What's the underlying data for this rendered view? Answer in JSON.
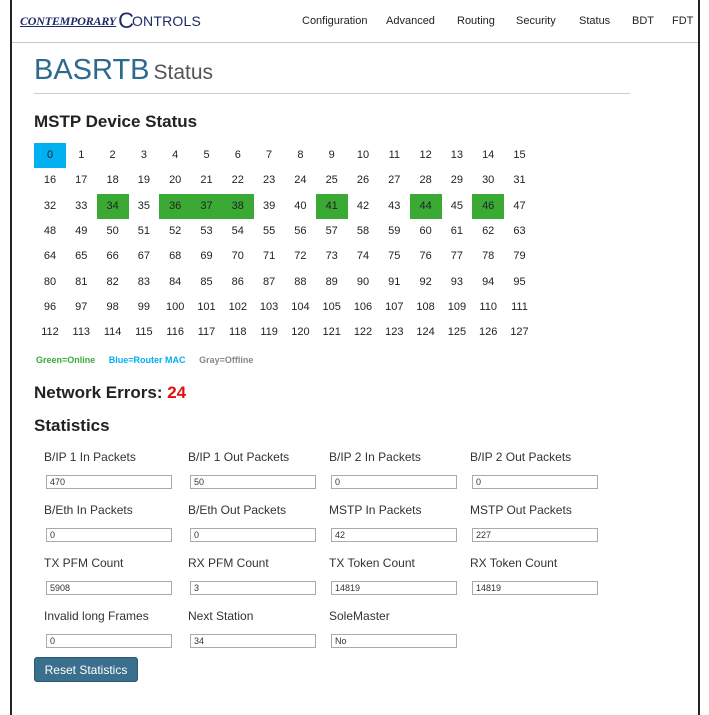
{
  "brand": {
    "line1": "CONTEMPORARY",
    "line2": "ONTROLS"
  },
  "nav": [
    "Configuration",
    "Advanced",
    "Routing",
    "Security",
    "Status",
    "BDT",
    "FDT"
  ],
  "title": {
    "main": "BASRTB",
    "sub": "Status"
  },
  "mstp": {
    "heading": "MSTP Device Status",
    "devices": [
      "0",
      "1",
      "2",
      "3",
      "4",
      "5",
      "6",
      "7",
      "8",
      "9",
      "10",
      "11",
      "12",
      "13",
      "14",
      "15",
      "16",
      "17",
      "18",
      "19",
      "20",
      "21",
      "22",
      "23",
      "24",
      "25",
      "26",
      "27",
      "28",
      "29",
      "30",
      "31",
      "32",
      "33",
      "34",
      "35",
      "36",
      "37",
      "38",
      "39",
      "40",
      "41",
      "42",
      "43",
      "44",
      "45",
      "46",
      "47",
      "48",
      "49",
      "50",
      "51",
      "52",
      "53",
      "54",
      "55",
      "56",
      "57",
      "58",
      "59",
      "60",
      "61",
      "62",
      "63",
      "64",
      "65",
      "66",
      "67",
      "68",
      "69",
      "70",
      "71",
      "72",
      "73",
      "74",
      "75",
      "76",
      "77",
      "78",
      "79",
      "80",
      "81",
      "82",
      "83",
      "84",
      "85",
      "86",
      "87",
      "88",
      "89",
      "90",
      "91",
      "92",
      "93",
      "94",
      "95",
      "96",
      "97",
      "98",
      "99",
      "100",
      "101",
      "102",
      "103",
      "104",
      "105",
      "106",
      "107",
      "108",
      "109",
      "110",
      "111",
      "112",
      "113",
      "114",
      "115",
      "116",
      "117",
      "118",
      "119",
      "120",
      "121",
      "122",
      "123",
      "124",
      "125",
      "126",
      "127"
    ],
    "router_mac": [
      0
    ],
    "online": [
      34,
      36,
      37,
      38,
      41,
      44,
      46
    ],
    "colors": {
      "online": "#3aaa35",
      "router": "#00b0f0",
      "offline": "#999999"
    }
  },
  "legend": {
    "green": "Green=Online",
    "blue": "Blue=Router MAC",
    "gray": "Gray=Offline"
  },
  "network_errors": {
    "label": "Network Errors:",
    "value": "24"
  },
  "statistics": {
    "heading": "Statistics",
    "fields": [
      {
        "label": "B/IP 1 In Packets",
        "value": "470"
      },
      {
        "label": "B/IP 1 Out Packets",
        "value": "50"
      },
      {
        "label": "B/IP 2 In Packets",
        "value": "0"
      },
      {
        "label": "B/IP 2 Out Packets",
        "value": "0"
      },
      {
        "label": "B/Eth In Packets",
        "value": "0"
      },
      {
        "label": "B/Eth Out Packets",
        "value": "0"
      },
      {
        "label": "MSTP In Packets",
        "value": "42"
      },
      {
        "label": "MSTP Out Packets",
        "value": "227"
      },
      {
        "label": "TX PFM Count",
        "value": "5908"
      },
      {
        "label": "RX PFM Count",
        "value": "3"
      },
      {
        "label": "TX Token Count",
        "value": "14819"
      },
      {
        "label": "RX Token Count",
        "value": "14819"
      },
      {
        "label": "Invalid long Frames",
        "value": "0"
      },
      {
        "label": "Next Station",
        "value": "34"
      },
      {
        "label": "SoleMaster",
        "value": "No"
      }
    ],
    "reset_label": "Reset Statistics"
  }
}
